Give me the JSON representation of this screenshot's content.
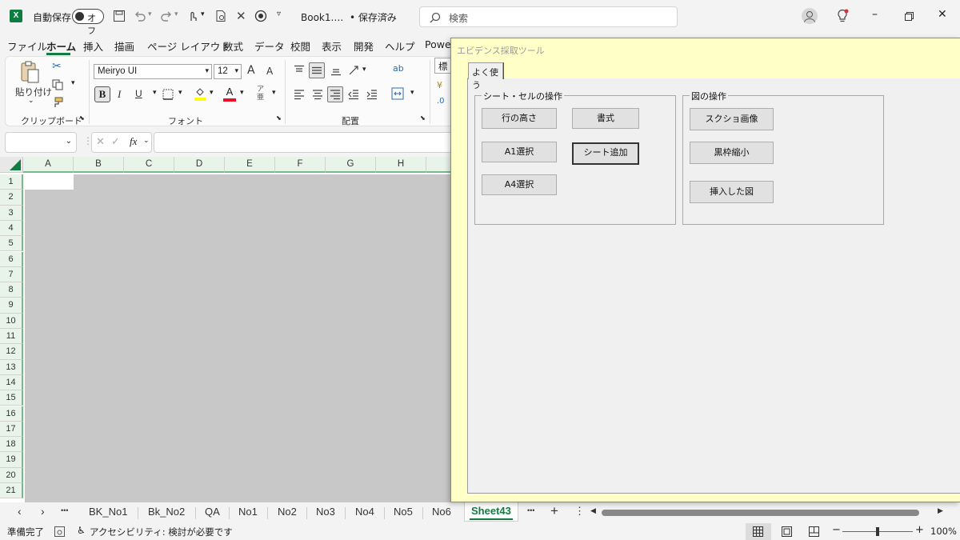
{
  "titlebar": {
    "autosave_label": "自動保存",
    "autosave_state": "オフ",
    "doc_title": "Book1.…  • 保存済み",
    "search_placeholder": "検索"
  },
  "menu": [
    "ファイル",
    "ホーム",
    "挿入",
    "描画",
    "ページ レイアウト",
    "数式",
    "データ",
    "校閲",
    "表示",
    "開発",
    "ヘルプ",
    "Power"
  ],
  "ribbon": {
    "paste_label": "貼り付け",
    "clipboard_label": "クリップボード",
    "font_name": "Meiryo UI",
    "font_size": "12",
    "font_label": "フォント",
    "align_label": "配置",
    "bold": "B",
    "italic": "I",
    "underline": "U",
    "number_format": "標準",
    "font_grow": "A",
    "font_shrink": "A",
    "font_color_letter": "A",
    "ab_text": "ab"
  },
  "formula": {
    "fx": "fx"
  },
  "sheet": {
    "columns": [
      "A",
      "B",
      "C",
      "D",
      "E",
      "F",
      "G",
      "H"
    ],
    "rows": [
      "1",
      "2",
      "3",
      "4",
      "5",
      "6",
      "7",
      "8",
      "9",
      "10",
      "11",
      "12",
      "13",
      "14",
      "15",
      "16",
      "17",
      "18",
      "19",
      "20",
      "21"
    ]
  },
  "sheet_tabs": {
    "tabs": [
      "BK_No1",
      "Bk_No2",
      "QA",
      "No1",
      "No2",
      "No3",
      "No4",
      "No5",
      "No6"
    ],
    "active": "Sheet43",
    "more": "•••",
    "add": "+"
  },
  "status": {
    "ready": "準備完了",
    "accessibility": "アクセシビリティ: 検討が必要です",
    "zoom": "100%"
  },
  "form": {
    "title": "エビデンス採取ツール",
    "tab_label": "よく使う",
    "frame1_label": "シート・セルの操作",
    "frame2_label": "図の操作",
    "buttons1": {
      "row_height": "行の高さ",
      "format": "書式",
      "select_a1": "A1選択",
      "add_sheet": "シート追加",
      "select_a4": "A4選択"
    },
    "buttons2": {
      "screenshot": "スクショ画像",
      "shrink_border": "黒枠縮小",
      "inserted_image": "挿入した図"
    }
  },
  "colors": {
    "excel_green": "#107c41",
    "header_highlight": "#e8f4ea",
    "form_bg": "#ffffc8",
    "form_panel": "#f0f0f0"
  }
}
